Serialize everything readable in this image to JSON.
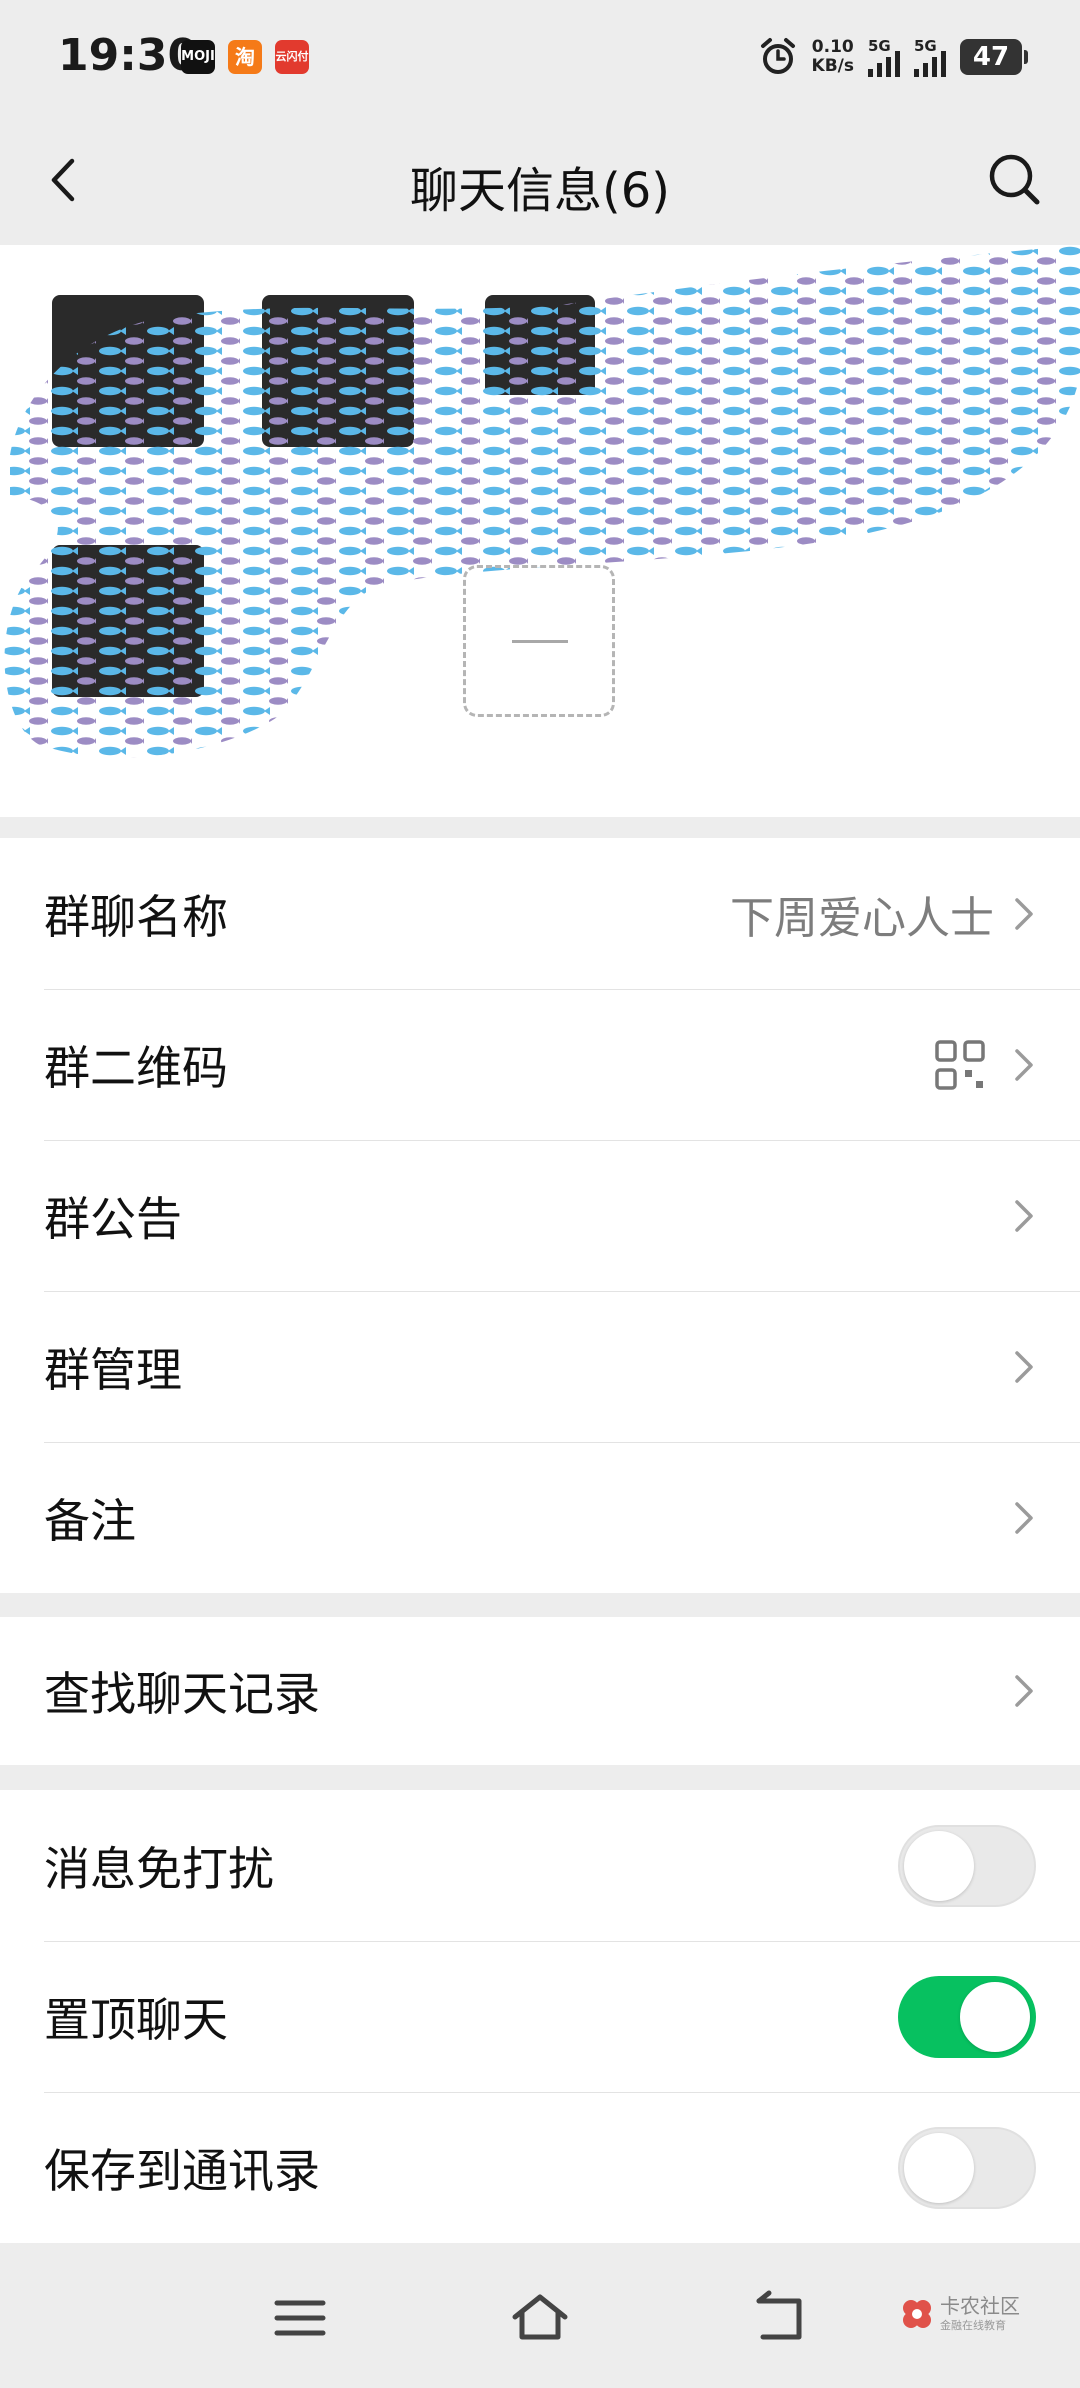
{
  "status_bar": {
    "time": "19:30",
    "apps": [
      "MOJI",
      "淘",
      "云闪付"
    ],
    "net_speed_value": "0.10",
    "net_speed_unit": "KB/s",
    "sim1": "5G",
    "sim2": "5G",
    "battery": "47"
  },
  "nav": {
    "title": "聊天信息(6)"
  },
  "settings_group_1": [
    {
      "label": "群聊名称",
      "value": "下周爱心人士"
    },
    {
      "label": "群二维码"
    },
    {
      "label": "群公告"
    },
    {
      "label": "群管理"
    },
    {
      "label": "备注"
    }
  ],
  "settings_group_2": [
    {
      "label": "查找聊天记录"
    }
  ],
  "settings_group_3": [
    {
      "label": "消息免打扰",
      "enabled": false
    },
    {
      "label": "置顶聊天",
      "enabled": true
    },
    {
      "label": "保存到通讯录",
      "enabled": false
    }
  ],
  "watermark": {
    "title": "卡农社区",
    "subtitle": "金融在线教育"
  },
  "colors": {
    "accent_green": "#07c160",
    "page_bg": "#ededed"
  }
}
